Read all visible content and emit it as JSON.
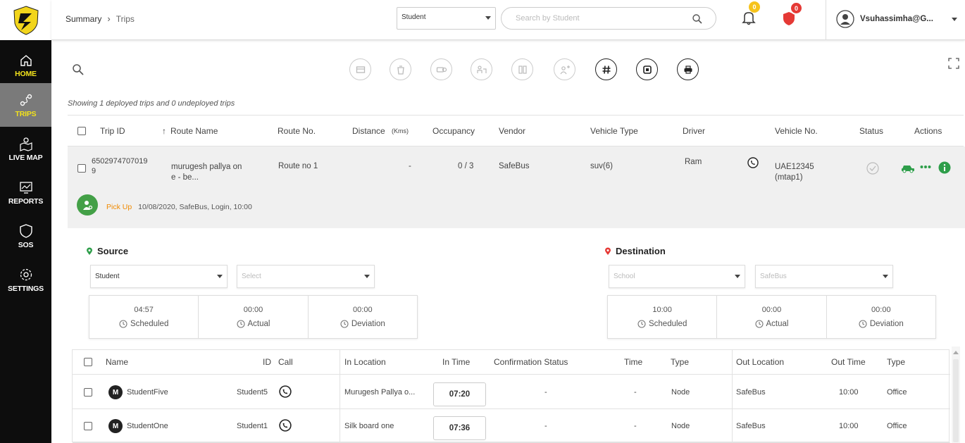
{
  "sidebar": {
    "items": [
      {
        "label": "HOME",
        "icon": "home-icon"
      },
      {
        "label": "TRIPS",
        "icon": "trips-icon"
      },
      {
        "label": "LIVE MAP",
        "icon": "live-map-icon"
      },
      {
        "label": "REPORTS",
        "icon": "reports-icon"
      },
      {
        "label": "SOS",
        "icon": "shield-icon"
      },
      {
        "label": "SETTINGS",
        "icon": "gear-icon"
      }
    ],
    "active": "TRIPS",
    "accent": "#f2e21c"
  },
  "header": {
    "breadcrumb": {
      "root": "Summary",
      "current": "Trips"
    },
    "filter_select": "Student",
    "search_placeholder": "Search by Student",
    "notification_count": "0",
    "sos_count": "0",
    "user": "Vsuhassimha@G..."
  },
  "status_text": "Showing 1 deployed trips and 0 undeployed trips",
  "trips_table": {
    "headers": {
      "trip_id": "Trip ID",
      "route_name": "Route Name",
      "route_no": "Route No.",
      "distance": "Distance",
      "distance_unit": "(Kms)",
      "occupancy": "Occupancy",
      "vendor": "Vendor",
      "vehicle_type": "Vehicle Type",
      "driver": "Driver",
      "vehicle_no": "Vehicle No.",
      "status": "Status",
      "actions": "Actions"
    },
    "sort_arrow": "↑",
    "row": {
      "trip_id_line1": "6502974707019",
      "trip_id_line2": "9",
      "route_name_line1": "murugesh pallya on",
      "route_name_line2": "e - be...",
      "route_no": "Route no 1",
      "distance": "-",
      "occupancy": "0 / 3",
      "vendor": "SafeBus",
      "vehicle_type": "suv(6)",
      "driver": "Ram",
      "vehicle_no_line1": "UAE12345",
      "vehicle_no_line2": "(mtap1)",
      "pickup_label": "Pick Up",
      "pickup_details": "10/08/2020, SafeBus, Login, 10:00"
    }
  },
  "source": {
    "title": "Source",
    "select1": "Student",
    "select2_placeholder": "Select",
    "scheduled_time": "04:57",
    "actual_time": "00:00",
    "deviation_time": "00:00",
    "scheduled_label": "Scheduled",
    "actual_label": "Actual",
    "deviation_label": "Deviation"
  },
  "destination": {
    "title": "Destination",
    "select1_placeholder": "School",
    "select2_placeholder": "SafeBus",
    "scheduled_time": "10:00",
    "actual_time": "00:00",
    "deviation_time": "00:00",
    "scheduled_label": "Scheduled",
    "actual_label": "Actual",
    "deviation_label": "Deviation"
  },
  "students_table": {
    "headers": {
      "name": "Name",
      "id": "ID",
      "call": "Call",
      "in_location": "In Location",
      "in_time": "In Time",
      "confirmation": "Confirmation Status",
      "time": "Time",
      "type": "Type",
      "out_location": "Out Location",
      "out_time": "Out Time",
      "out_type": "Type"
    },
    "rows": [
      {
        "avatar": "M",
        "name": "StudentFive",
        "id": "Student5",
        "in_location": "Murugesh Pallya o...",
        "in_time": "07:20",
        "confirmation": "-",
        "time": "-",
        "type": "Node",
        "out_location": "SafeBus",
        "out_time": "10:00",
        "out_type": "Office"
      },
      {
        "avatar": "M",
        "name": "StudentOne",
        "id": "Student1",
        "in_location": "Silk board one",
        "in_time": "07:36",
        "confirmation": "-",
        "time": "-",
        "type": "Node",
        "out_location": "SafeBus",
        "out_time": "10:00",
        "out_type": "Office"
      }
    ]
  },
  "colors": {
    "sidebar_bg": "#0d0d0d",
    "active_item_bg": "#7a7a7a",
    "pickup_green": "#43a047",
    "pickup_orange": "#f08a00",
    "notification_badge": "#f6c31c",
    "sos_badge": "#e53935",
    "source_pin": "#2e9e4a",
    "destination_pin": "#e53935"
  }
}
